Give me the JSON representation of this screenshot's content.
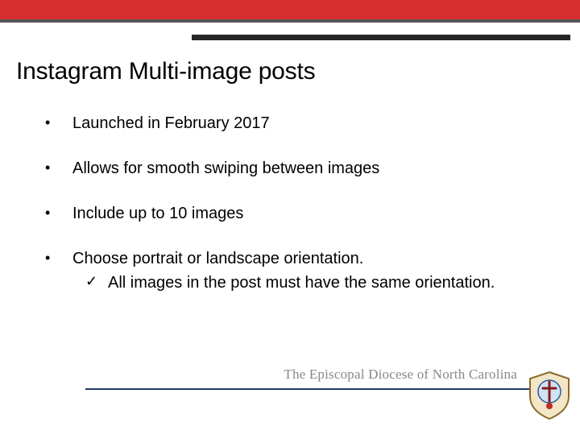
{
  "title": "Instagram Multi-image posts",
  "bullets": [
    {
      "text": "Launched in February 2017"
    },
    {
      "text": "Allows for smooth swiping between images"
    },
    {
      "text": "Include up to 10 images"
    },
    {
      "text": "Choose portrait or landscape orientation.",
      "sub": "All images in the post must have the same orientation."
    }
  ],
  "footer": "The Episcopal Diocese of North Carolina",
  "glyphs": {
    "bullet": "•",
    "check": "✓"
  }
}
